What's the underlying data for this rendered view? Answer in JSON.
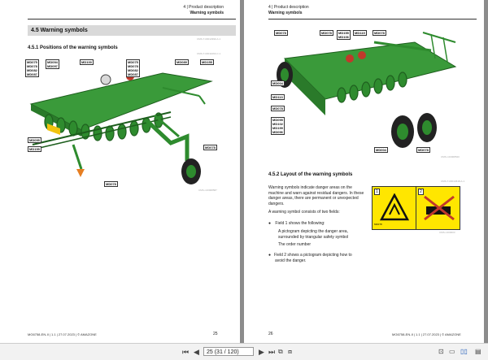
{
  "left_page": {
    "header_chapter": "4 | Product description",
    "header_title": "Warning symbols",
    "section_title": "4.5  Warning symbols",
    "section_ref": "CMS-T-00012990-A.1",
    "subsection_title": "4.5.1  Positions of the warning symbols",
    "subsection_ref": "CMS-T-00011063-C.1",
    "figure_ref": "CMS-I-00008587",
    "labels": {
      "group1": [
        "MD075",
        "MD078",
        "MD082",
        "MD087"
      ],
      "group2": [
        "MD094",
        "MD097"
      ],
      "md100": "MD100",
      "group3": [
        "MD075",
        "MD078",
        "MD082",
        "MD087"
      ],
      "md089": "MD089",
      "md155_top": "MD155",
      "md095": "MD095",
      "md155_left": "MD155",
      "md078_right": "MD078",
      "md078_bottom": "MD078"
    },
    "footer": "MG6758-EN-II | 1.1 | 27.07.2023 | © AMAZONE",
    "page_number": "25"
  },
  "right_page": {
    "header_chapter": "4 | Product description",
    "header_title": "Warning symbols",
    "labels": {
      "md078": "MD078",
      "md078b": "MD078",
      "md155_md106": [
        "MD155",
        "MD106"
      ],
      "md119": "MD119",
      "md078c": "MD078",
      "md004": "MD004",
      "md113": "MD113",
      "md078d": "MD078",
      "stack": [
        "MD095",
        "MD102",
        "MD199",
        "MD096"
      ],
      "md004b": "MD004",
      "md078e": "MD078"
    },
    "figure_ref": "CMS-I-00008520",
    "subsection_title": "4.5.2  Layout of the warning symbols",
    "subsection_ref": "CMS-T-00014618-A.1",
    "paragraph1": [
      "Warning symbols indicate danger areas on the",
      "machine and warn against residual dangers. In these",
      "danger areas, there are permanent or unexpected",
      "dangers."
    ],
    "paragraph2": "A warning symbol consists of two fields:",
    "bullet1": "Field 1 shows the following:",
    "sub1a": [
      "A pictogram depicting the danger area,",
      "surrounded by triangular safety symbol"
    ],
    "sub1b": "The order number",
    "bullet2": [
      "Field 2 shows a pictogram depicting how to",
      "avoid the danger."
    ],
    "warning_order_number": "MD078",
    "warning_field1_number": "1",
    "warning_field2_number": "2",
    "warning_ref": "CMS-I-000003",
    "footer": "MG6758-EN-II | 1.1 | 27.07.2023 | © AMAZONE",
    "page_number": "26"
  },
  "toolbar": {
    "page_input": "25 (31 / 120)"
  },
  "colors": {
    "machine_green": "#2e8b2e",
    "warning_yellow": "#ffe600",
    "viewer_bg": "#8c8c8c"
  }
}
